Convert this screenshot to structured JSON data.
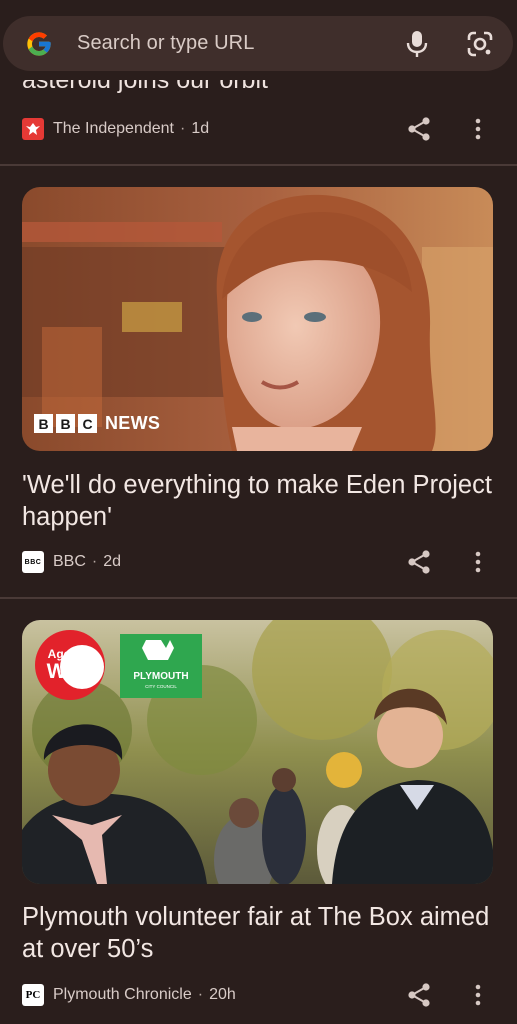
{
  "search": {
    "placeholder": "Search or type URL"
  },
  "colors": {
    "background": "#2a1e1c",
    "pill": "#3f2e2b",
    "text": "#efe3df",
    "divider": "#4a3a37"
  },
  "articles": [
    {
      "title_fragment": "asteroid joins our orbit",
      "source": "The Independent",
      "age": "1d",
      "icon": "independent-eagle-icon"
    },
    {
      "title": "'We'll do everything to make Eden Project happen'",
      "image_overlay": {
        "logo_letters": [
          "B",
          "B",
          "C"
        ],
        "logo_word": "NEWS"
      },
      "source": "BBC",
      "source_icon_text": "BBC",
      "age": "2d"
    },
    {
      "title": "Plymouth volunteer fair at The Box aimed at over 50’s",
      "image_overlay": {
        "ageing_line1": "Ageing",
        "ageing_line2": "Well",
        "council_name": "PLYMOUTH",
        "council_sub": "CITY COUNCIL"
      },
      "source": "Plymouth Chronicle",
      "source_icon_text": "PC",
      "age": "20h"
    }
  ],
  "separator": "·"
}
